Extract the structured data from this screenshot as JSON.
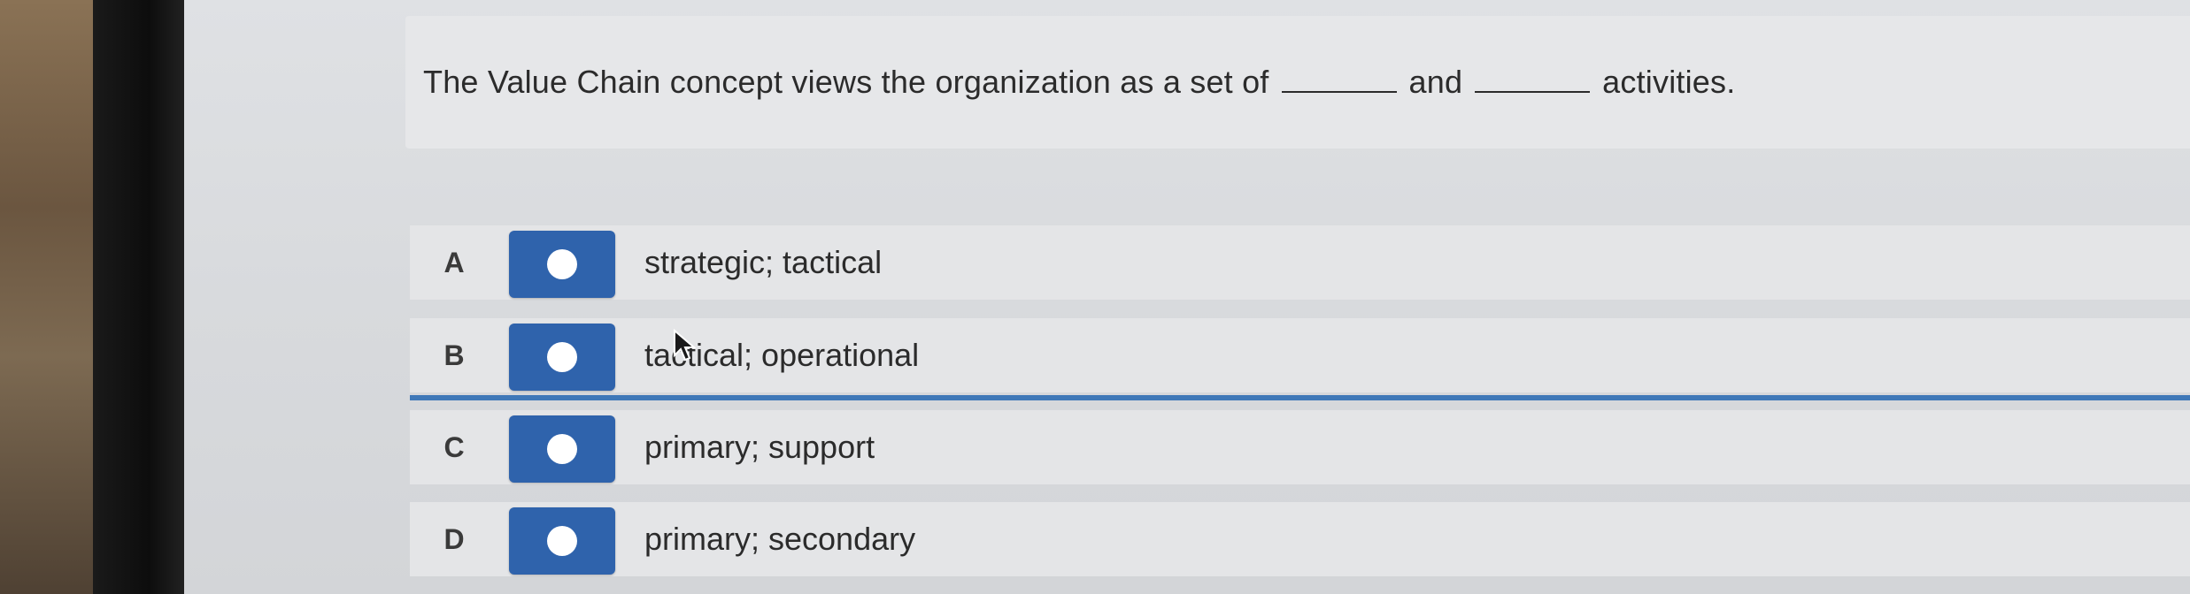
{
  "question": {
    "part1": "The Value Chain concept views the organization as a set of",
    "part2": "and",
    "part3": "activities."
  },
  "options": [
    {
      "letter": "A",
      "text": "strategic; tactical"
    },
    {
      "letter": "B",
      "text": "tactical; operational"
    },
    {
      "letter": "C",
      "text": "primary; support"
    },
    {
      "letter": "D",
      "text": "primary; secondary"
    }
  ],
  "colors": {
    "radio_button": "#2f63ac",
    "focus_line": "#3f78b8"
  },
  "icons": {
    "cursor": "mouse-pointer-icon",
    "radio": "radio-button-icon"
  }
}
